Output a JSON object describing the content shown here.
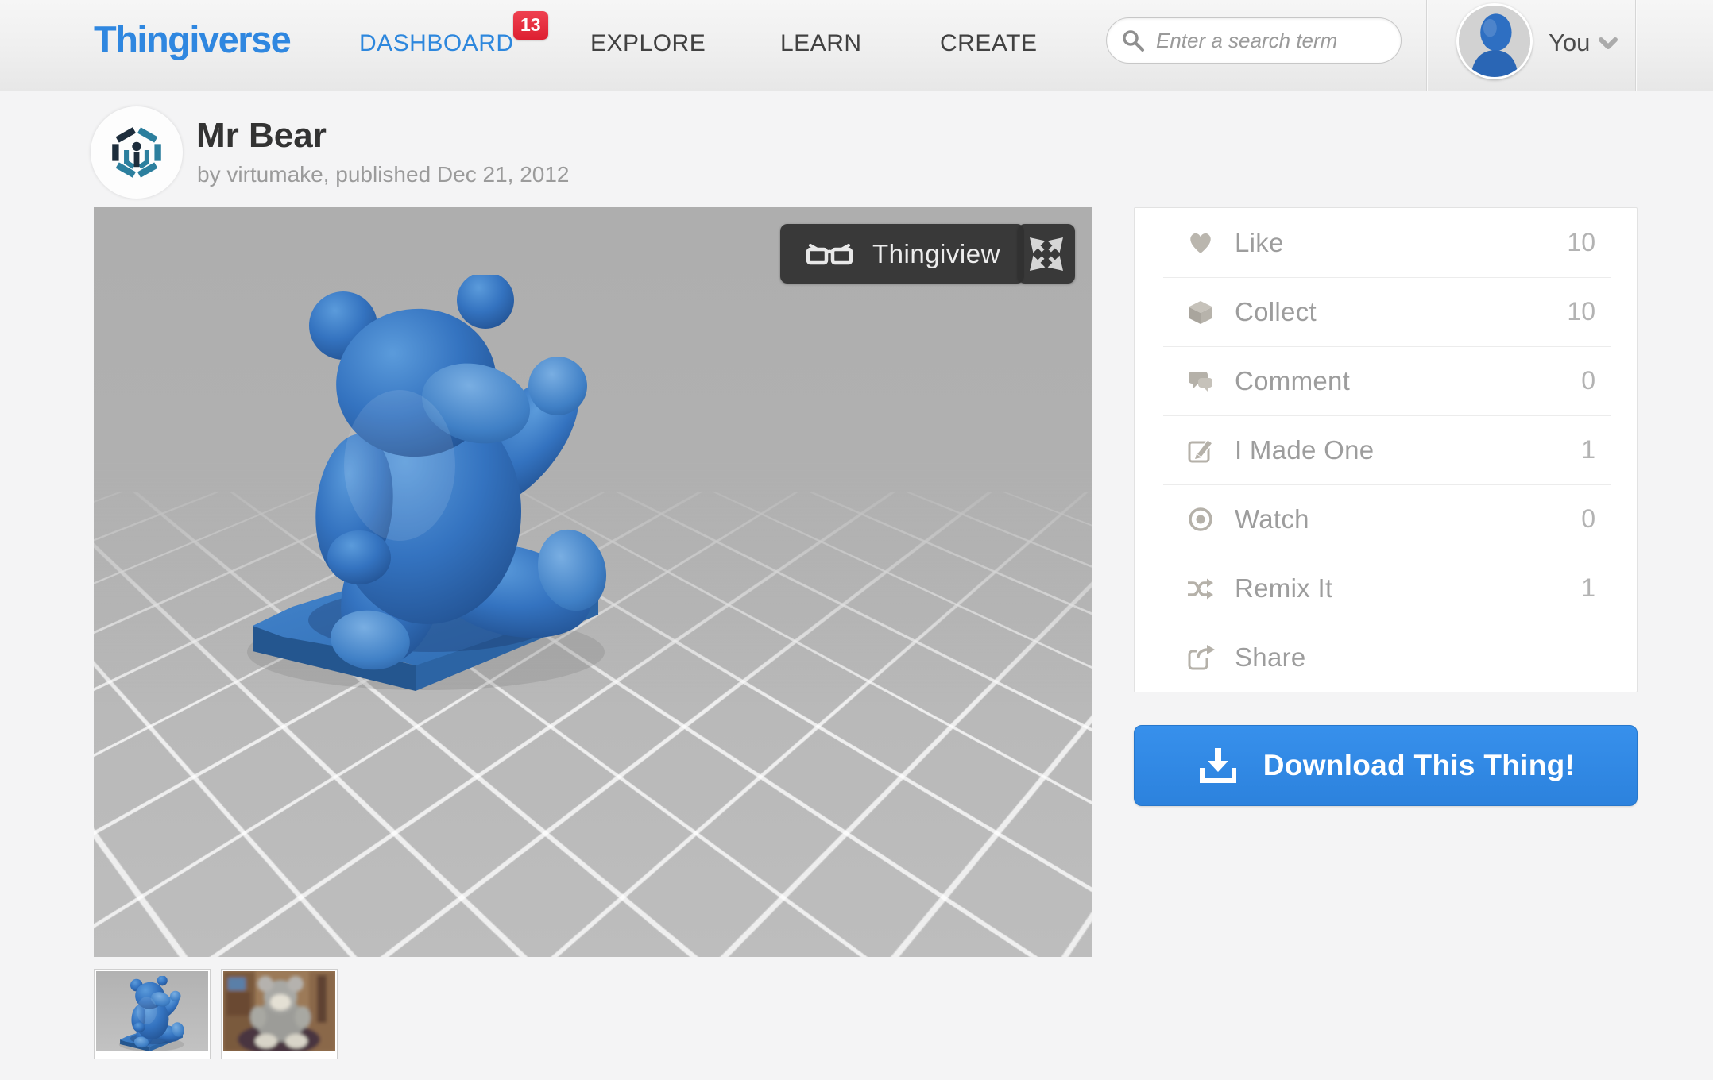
{
  "colors": {
    "brand_blue": "#2f87e0",
    "badge_red": "#dd2233",
    "download_blue": "#2f87e2",
    "model_blue": "#3473c0"
  },
  "header": {
    "logo": "Thingiverse",
    "nav": {
      "dashboard": "DASHBOARD",
      "dashboard_badge": "13",
      "explore": "EXPLORE",
      "learn": "LEARN",
      "create": "CREATE"
    },
    "search": {
      "placeholder": "Enter a search term"
    },
    "user": {
      "label": "You"
    }
  },
  "thing": {
    "title": "Mr Bear",
    "byline": "by virtumake, published Dec 21, 2012"
  },
  "viewer": {
    "thingiview": "Thingiview"
  },
  "actions": [
    {
      "label": "Like",
      "count": "10"
    },
    {
      "label": "Collect",
      "count": "10"
    },
    {
      "label": "Comment",
      "count": "0"
    },
    {
      "label": "I Made One",
      "count": "1"
    },
    {
      "label": "Watch",
      "count": "0"
    },
    {
      "label": "Remix It",
      "count": "1"
    },
    {
      "label": "Share",
      "count": ""
    }
  ],
  "download": {
    "label": "Download This Thing!"
  }
}
